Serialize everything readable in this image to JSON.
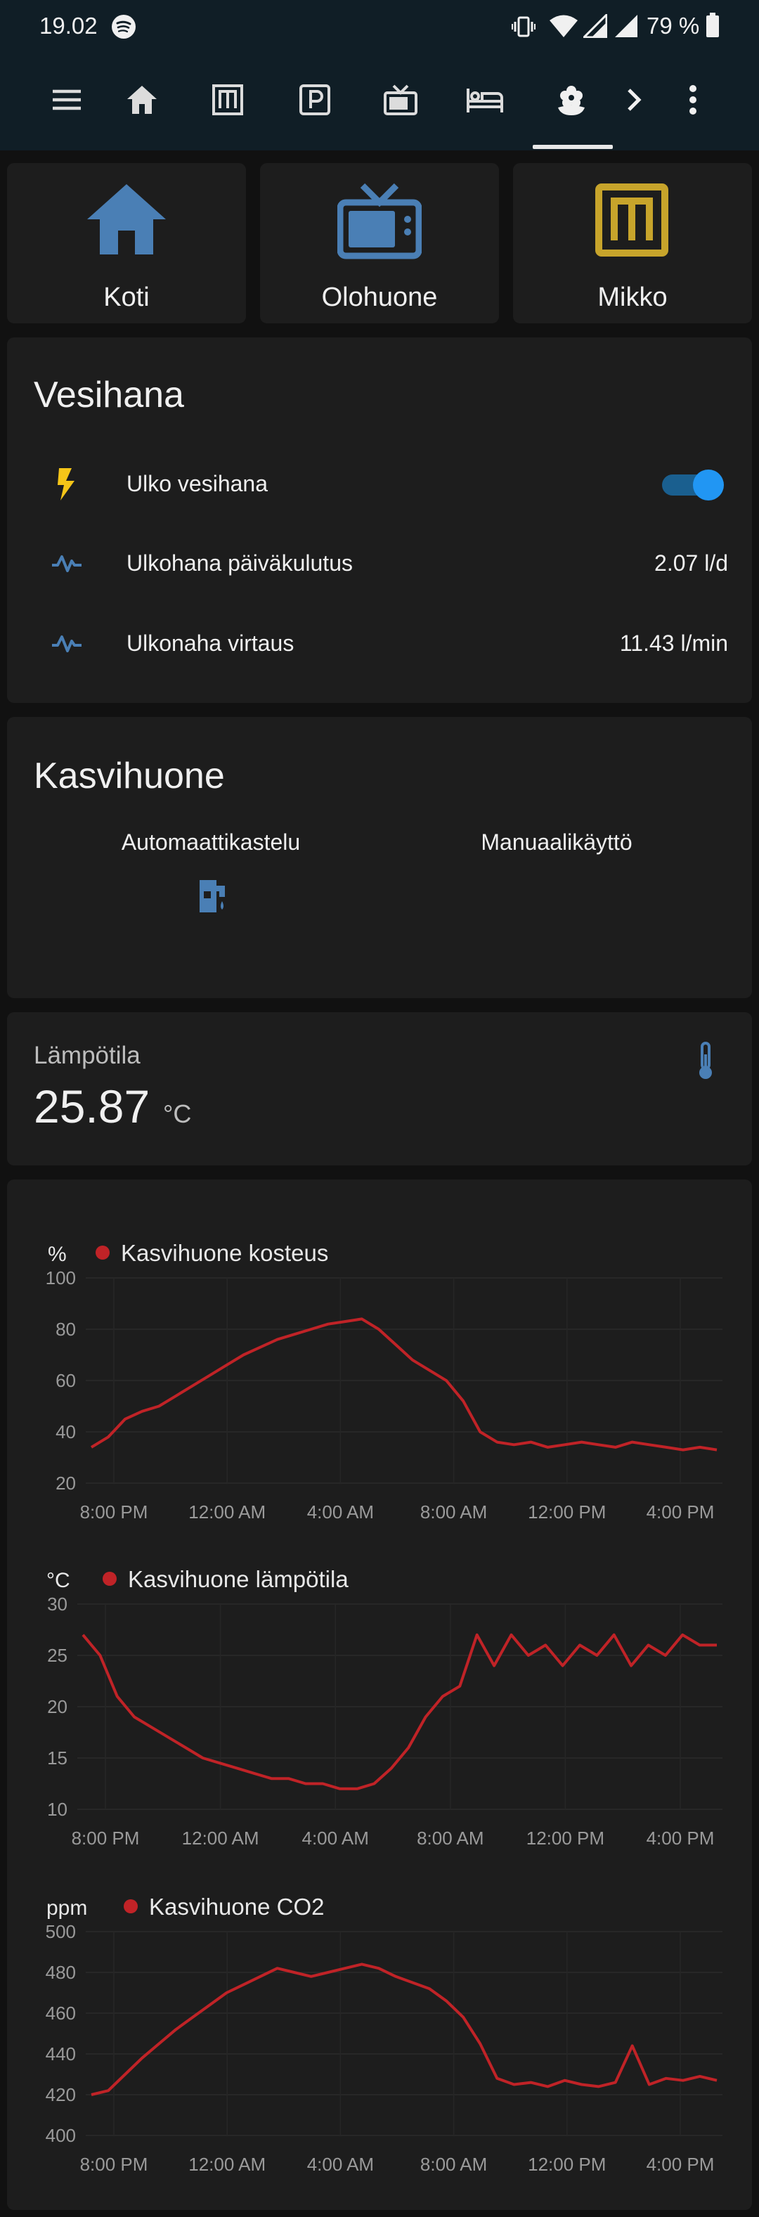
{
  "status": {
    "time": "19.02",
    "battery": "79 %"
  },
  "nav": {
    "tabs": [
      "menu-icon",
      "home-icon",
      "m-logo-icon",
      "parking-icon",
      "tv-icon",
      "bed-icon",
      "flower-icon"
    ],
    "active_tab": "flower-icon"
  },
  "shortcuts": [
    {
      "label": "Koti",
      "icon": "home-icon",
      "color": "#4a7fb5"
    },
    {
      "label": "Olohuone",
      "icon": "tv-icon",
      "color": "#4a7fb5"
    },
    {
      "label": "Mikko",
      "icon": "m-logo-icon",
      "color": "#c7a42b"
    }
  ],
  "vesihana": {
    "title": "Vesihana",
    "rows": [
      {
        "label": "Ulko vesihana",
        "icon": "lightning-icon",
        "value": "",
        "toggle": true
      },
      {
        "label": "Ulkohana päiväkulutus",
        "icon": "pulse-icon",
        "value": "2.07 l/d"
      },
      {
        "label": "Ulkonaha virtaus",
        "icon": "pulse-icon",
        "value": "11.43 l/min"
      }
    ]
  },
  "kasvihuone": {
    "title": "Kasvihuone",
    "buttons": [
      {
        "label": "Automaattikastelu",
        "icon": "water-pump-icon"
      },
      {
        "label": "Manuaalikäyttö",
        "icon": ""
      }
    ]
  },
  "temperature": {
    "label": "Lämpötila",
    "value": "25.87",
    "unit": "°C"
  },
  "colors": {
    "accent": "#4a7fb5",
    "series": "#c02327",
    "toggle": "#2196f3",
    "lightning": "#f5c518"
  },
  "chart_data": [
    {
      "type": "line",
      "unit": "%",
      "series": [
        {
          "name": "Kasvihuone kosteus",
          "y": [
            34,
            38,
            45,
            48,
            50,
            54,
            58,
            62,
            66,
            70,
            73,
            76,
            78,
            80,
            82,
            83,
            84,
            80,
            74,
            68,
            64,
            60,
            52,
            40,
            36,
            35,
            36,
            34,
            35,
            36,
            35,
            34,
            36,
            35,
            34,
            33,
            34,
            33
          ]
        }
      ],
      "x_ticks": [
        "8:00 PM",
        "12:00 AM",
        "4:00 AM",
        "8:00 AM",
        "12:00 PM",
        "4:00 PM"
      ],
      "y_ticks": [
        100,
        80,
        60,
        40,
        20
      ],
      "ylim": [
        20,
        100
      ]
    },
    {
      "type": "line",
      "unit": "°C",
      "series": [
        {
          "name": "Kasvihuone lämpötila",
          "y": [
            27,
            25,
            21,
            19,
            18,
            17,
            16,
            15,
            14.5,
            14,
            13.5,
            13,
            13,
            12.5,
            12.5,
            12,
            12,
            12.5,
            14,
            16,
            19,
            21,
            22,
            27,
            24,
            27,
            25,
            26,
            24,
            26,
            25,
            27,
            24,
            26,
            25,
            27,
            26,
            26
          ]
        }
      ],
      "x_ticks": [
        "8:00 PM",
        "12:00 AM",
        "4:00 AM",
        "8:00 AM",
        "12:00 PM",
        "4:00 PM"
      ],
      "y_ticks": [
        30,
        25,
        20,
        15,
        10
      ],
      "ylim": [
        10,
        30
      ]
    },
    {
      "type": "line",
      "unit": "ppm",
      "series": [
        {
          "name": "Kasvihuone CO2",
          "y": [
            420,
            422,
            430,
            438,
            445,
            452,
            458,
            464,
            470,
            474,
            478,
            482,
            480,
            478,
            480,
            482,
            484,
            482,
            478,
            475,
            472,
            466,
            458,
            445,
            428,
            425,
            426,
            424,
            427,
            425,
            424,
            426,
            444,
            425,
            428,
            427,
            429,
            427
          ]
        }
      ],
      "x_ticks": [
        "8:00 PM",
        "12:00 AM",
        "4:00 AM",
        "8:00 AM",
        "12:00 PM",
        "4:00 PM"
      ],
      "y_ticks": [
        500,
        480,
        460,
        440,
        420,
        400
      ],
      "ylim": [
        400,
        500
      ]
    }
  ]
}
